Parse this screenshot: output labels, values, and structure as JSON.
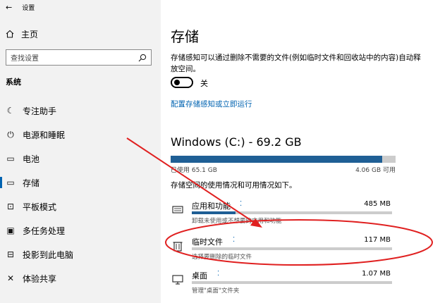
{
  "window": {
    "title": "设置"
  },
  "sidebar": {
    "home_label": "主页",
    "search_placeholder": "查找设置",
    "section_label": "系统",
    "items": [
      {
        "label": "专注助手",
        "icon": "moon-icon",
        "active": false
      },
      {
        "label": "电源和睡眠",
        "icon": "power-icon",
        "active": false
      },
      {
        "label": "电池",
        "icon": "battery-icon",
        "active": false
      },
      {
        "label": "存储",
        "icon": "storage-icon",
        "active": true
      },
      {
        "label": "平板模式",
        "icon": "tablet-icon",
        "active": false
      },
      {
        "label": "多任务处理",
        "icon": "multitask-icon",
        "active": false
      },
      {
        "label": "投影到此电脑",
        "icon": "project-icon",
        "active": false
      },
      {
        "label": "体验共享",
        "icon": "share-icon",
        "active": false
      }
    ]
  },
  "main": {
    "title": "存储",
    "description": "存储感知可以通过删除不需要的文件(例如临时文件和回收站中的内容)自动释放空间。",
    "toggle_label": "关",
    "toggle_on": false,
    "configure_link": "配置存储感知或立即运行",
    "drive": {
      "title": "Windows (C:) - 69.2 GB",
      "used_label": "已使用 65.1 GB",
      "free_label": "4.06 GB 可用",
      "used_fraction": 0.94
    },
    "usage_desc": "存储空间的使用情况和可用情况如下。",
    "categories": [
      {
        "name": "应用和功能",
        "size": "485 MB",
        "desc": "卸载未使用或不想要的应用和功能",
        "icon": "apps-icon",
        "fill": 0.22
      },
      {
        "name": "临时文件",
        "size": "117 MB",
        "desc": "选择要删除的临时文件",
        "icon": "trash-icon",
        "fill": 0.0
      },
      {
        "name": "桌面",
        "size": "1.07 MB",
        "desc": "管理\"桌面\"文件夹",
        "icon": "desktop-icon",
        "fill": 0.0
      }
    ]
  },
  "colors": {
    "accent": "#0063b1",
    "bar_fill": "#1f5f95",
    "annotation": "#e02020"
  }
}
